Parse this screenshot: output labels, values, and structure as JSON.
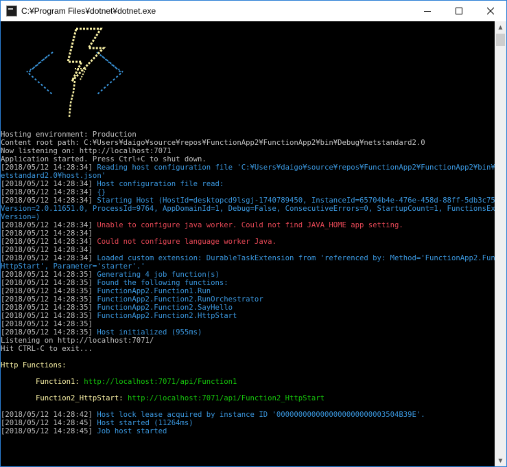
{
  "window": {
    "title": "C:¥Program Files¥dotnet¥dotnet.exe",
    "icon": "console-app-icon",
    "controls": [
      "minimize",
      "maximize",
      "close"
    ]
  },
  "logo": {
    "description_icon": "azure-functions-lightning-logo",
    "colors": {
      "bolt": "#f9f1a5",
      "brackets": "#3a96dd"
    }
  },
  "console": {
    "lines": [
      {
        "parts": [
          {
            "t": "Hosting environment: Production",
            "c": "gray"
          }
        ]
      },
      {
        "parts": [
          {
            "t": "Content root path: C:¥Users¥daigo¥source¥repos¥FunctionApp2¥FunctionApp2¥bin¥Debug¥netstandard2.0",
            "c": "gray"
          }
        ]
      },
      {
        "parts": [
          {
            "t": "Now listening on: http://localhost:7071",
            "c": "gray"
          }
        ]
      },
      {
        "parts": [
          {
            "t": "Application started. Press Ctrl+C to shut down.",
            "c": "gray"
          }
        ]
      },
      {
        "parts": [
          {
            "t": "[2018/05/12 14:28:34] ",
            "c": "ts"
          },
          {
            "t": "Reading host configuration file 'C:¥Users¥daigo¥source¥repos¥FunctionApp2¥FunctionApp2¥bin¥Debug¥n",
            "c": "cyan"
          }
        ]
      },
      {
        "parts": [
          {
            "t": "etstandard2.0¥host.json'",
            "c": "cyan"
          }
        ]
      },
      {
        "parts": [
          {
            "t": "[2018/05/12 14:28:34] ",
            "c": "ts"
          },
          {
            "t": "Host configuration file read:",
            "c": "cyan"
          }
        ]
      },
      {
        "parts": [
          {
            "t": "[2018/05/12 14:28:34] ",
            "c": "ts"
          },
          {
            "t": "{}",
            "c": "cyan"
          }
        ]
      },
      {
        "parts": [
          {
            "t": "[2018/05/12 14:28:34] ",
            "c": "ts"
          },
          {
            "t": "Starting Host (HostId=desktopcd9lsgj-1740789450, InstanceId=65704b4e-476e-458d-88ff-5db3c752dfc6,",
            "c": "cyan"
          }
        ]
      },
      {
        "parts": [
          {
            "t": "Version=2.0.11651.0, ProcessId=9764, AppDomainId=1, Debug=False, ConsecutiveErrors=0, StartupCount=1, FunctionsExtension",
            "c": "cyan"
          }
        ]
      },
      {
        "parts": [
          {
            "t": "Version=)",
            "c": "cyan"
          }
        ]
      },
      {
        "parts": [
          {
            "t": "[2018/05/12 14:28:34] ",
            "c": "ts"
          },
          {
            "t": "Unable to configure java worker. Could not find JAVA_HOME app setting.",
            "c": "red"
          }
        ]
      },
      {
        "parts": [
          {
            "t": "[2018/05/12 14:28:34]",
            "c": "ts"
          }
        ]
      },
      {
        "parts": [
          {
            "t": "[2018/05/12 14:28:34] ",
            "c": "ts"
          },
          {
            "t": "Could not configure language worker Java.",
            "c": "red"
          }
        ]
      },
      {
        "parts": [
          {
            "t": "[2018/05/12 14:28:34]",
            "c": "ts"
          }
        ]
      },
      {
        "parts": [
          {
            "t": "[2018/05/12 14:28:34] ",
            "c": "ts"
          },
          {
            "t": "Loaded custom extension: DurableTaskExtension from 'referenced by: Method='FunctionApp2.Function2.",
            "c": "cyan"
          }
        ]
      },
      {
        "parts": [
          {
            "t": "HttpStart', Parameter='starter'.'",
            "c": "cyan"
          }
        ]
      },
      {
        "parts": [
          {
            "t": "[2018/05/12 14:28:35] ",
            "c": "ts"
          },
          {
            "t": "Generating 4 job function(s)",
            "c": "cyan"
          }
        ]
      },
      {
        "parts": [
          {
            "t": "[2018/05/12 14:28:35] ",
            "c": "ts"
          },
          {
            "t": "Found the following functions:",
            "c": "cyan"
          }
        ]
      },
      {
        "parts": [
          {
            "t": "[2018/05/12 14:28:35] ",
            "c": "ts"
          },
          {
            "t": "FunctionApp2.Function1.Run",
            "c": "cyan"
          }
        ]
      },
      {
        "parts": [
          {
            "t": "[2018/05/12 14:28:35] ",
            "c": "ts"
          },
          {
            "t": "FunctionApp2.Function2.RunOrchestrator",
            "c": "cyan"
          }
        ]
      },
      {
        "parts": [
          {
            "t": "[2018/05/12 14:28:35] ",
            "c": "ts"
          },
          {
            "t": "FunctionApp2.Function2.SayHello",
            "c": "cyan"
          }
        ]
      },
      {
        "parts": [
          {
            "t": "[2018/05/12 14:28:35] ",
            "c": "ts"
          },
          {
            "t": "FunctionApp2.Function2.HttpStart",
            "c": "cyan"
          }
        ]
      },
      {
        "parts": [
          {
            "t": "[2018/05/12 14:28:35]",
            "c": "ts"
          }
        ]
      },
      {
        "parts": [
          {
            "t": "[2018/05/12 14:28:35] ",
            "c": "ts"
          },
          {
            "t": "Host initialized (955ms)",
            "c": "cyan"
          }
        ]
      },
      {
        "parts": [
          {
            "t": "Listening on http://localhost:7071/",
            "c": "gray"
          }
        ]
      },
      {
        "parts": [
          {
            "t": "Hit CTRL-C to exit...",
            "c": "gray"
          }
        ]
      },
      {
        "parts": []
      },
      {
        "parts": [
          {
            "t": "Http Functions:",
            "c": "yellow"
          }
        ]
      },
      {
        "parts": []
      },
      {
        "parts": [
          {
            "t": "        Function1: ",
            "c": "yellow"
          },
          {
            "t": "http://localhost:7071/api/Function1",
            "c": "green"
          }
        ]
      },
      {
        "parts": []
      },
      {
        "parts": [
          {
            "t": "        Function2_HttpStart: ",
            "c": "yellow"
          },
          {
            "t": "http://localhost:7071/api/Function2_HttpStart",
            "c": "green"
          }
        ]
      },
      {
        "parts": []
      },
      {
        "parts": [
          {
            "t": "[2018/05/12 14:28:42] ",
            "c": "ts"
          },
          {
            "t": "Host lock lease acquired by instance ID '0000000000000000000000003504B39E'.",
            "c": "cyan"
          }
        ]
      },
      {
        "parts": [
          {
            "t": "[2018/05/12 14:28:45] ",
            "c": "ts"
          },
          {
            "t": "Host started (11264ms)",
            "c": "cyan"
          }
        ]
      },
      {
        "parts": [
          {
            "t": "[2018/05/12 14:28:45] ",
            "c": "ts"
          },
          {
            "t": "Job host started",
            "c": "cyan"
          }
        ]
      }
    ]
  }
}
